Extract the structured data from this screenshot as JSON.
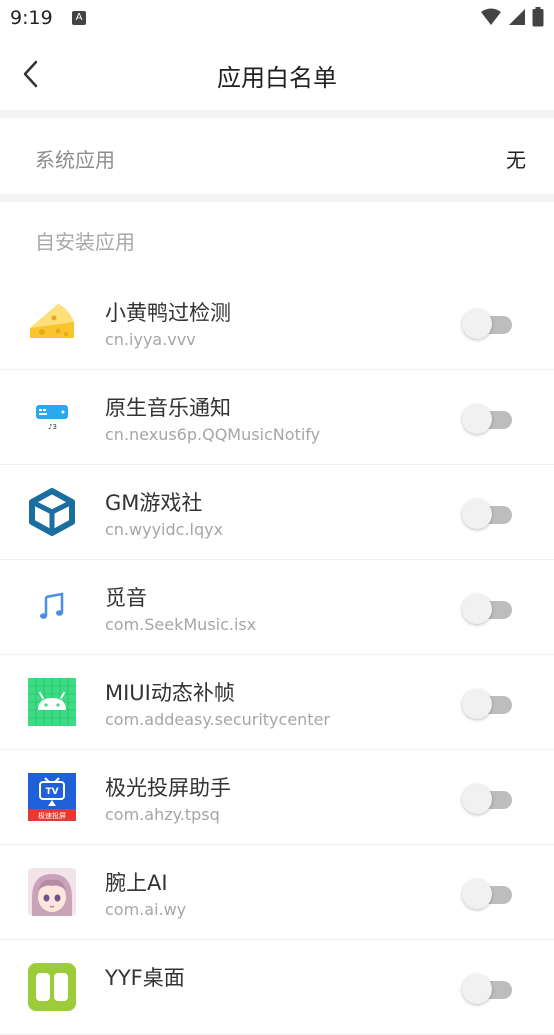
{
  "status_bar": {
    "time": "9:19",
    "notification_icon": "A"
  },
  "header": {
    "title": "应用白名单",
    "back_icon": "chevron-left-icon"
  },
  "system_apps": {
    "label": "系统应用",
    "value": "无"
  },
  "installed_apps": {
    "label": "自安装应用",
    "items": [
      {
        "name": "小黄鸭过检测",
        "package": "cn.iyya.vvv",
        "icon": "cheese-icon",
        "enabled": false
      },
      {
        "name": "原生音乐通知",
        "package": "cn.nexus6p.QQMusicNotify",
        "icon": "music-notify-icon",
        "enabled": false
      },
      {
        "name": "GM游戏社",
        "package": "cn.wyyidc.lqyx",
        "icon": "cube-logo-icon",
        "enabled": false
      },
      {
        "name": "觅音",
        "package": "com.SeekMusic.isx",
        "icon": "music-note-icon",
        "enabled": false
      },
      {
        "name": "MIUI动态补帧",
        "package": "com.addeasy.securitycenter",
        "icon": "android-icon",
        "enabled": false
      },
      {
        "name": "极光投屏助手",
        "package": "com.ahzy.tpsq",
        "icon": "tv-cast-icon",
        "enabled": false,
        "icon_text": "TV",
        "icon_caption": "极速投屏"
      },
      {
        "name": "腕上AI",
        "package": "com.ai.wy",
        "icon": "anime-avatar-icon",
        "enabled": false
      },
      {
        "name": "YYF桌面",
        "package": "",
        "icon": "yyf-desktop-icon",
        "enabled": false
      }
    ]
  }
}
